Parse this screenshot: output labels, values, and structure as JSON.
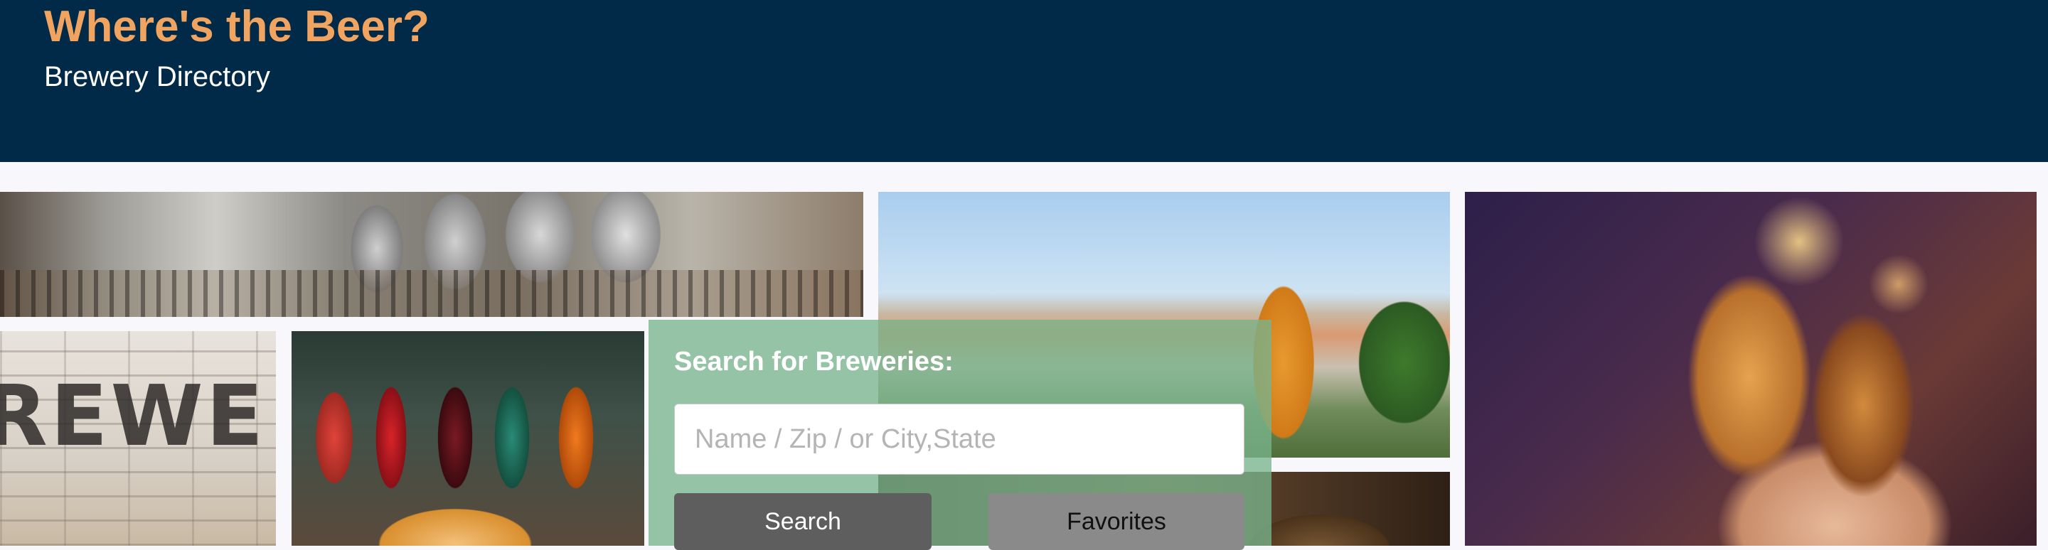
{
  "header": {
    "title": "Where's the Beer?",
    "subtitle": "Brewery Directory"
  },
  "gallery": {
    "photos": [
      "brewhouse-photo",
      "prague-beer-photo",
      "cheers-photo",
      "brick-wall-photo",
      "beer-taps-photo",
      "barrels-photo"
    ],
    "brick_text": "REWE"
  },
  "search": {
    "heading": "Search for Breweries:",
    "placeholder": "Name / Zip / or City,State",
    "value": "",
    "search_label": "Search",
    "favorites_label": "Favorites"
  },
  "colors": {
    "header_bg": "#002a47",
    "title_color": "#f0a45f",
    "panel_bg": "#78b48c",
    "search_button": "#5e5e5e",
    "favorites_button": "#8a8a8a"
  }
}
